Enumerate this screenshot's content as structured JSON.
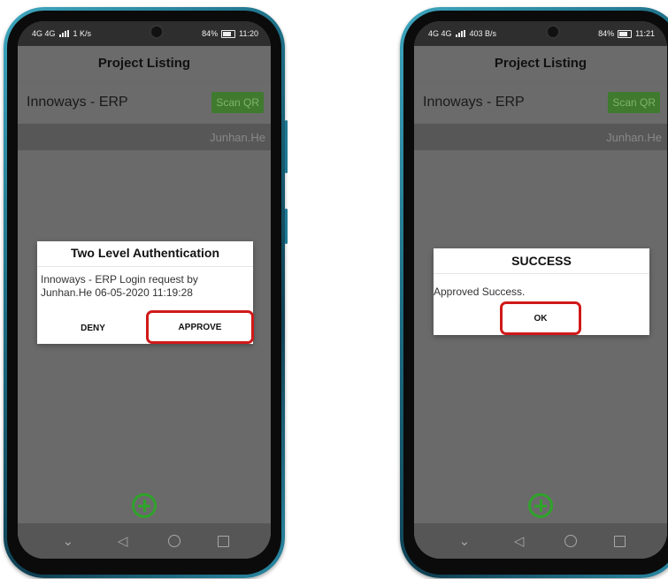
{
  "screen_left": {
    "status": {
      "left_icons": "4G 4G",
      "speed": "1 K/s",
      "right_status": "84%",
      "time": "11:20"
    },
    "app_title": "Project Listing",
    "project": {
      "name": "Innoways - ERP",
      "scan_label": "Scan QR"
    },
    "user": "Junhan.He",
    "dialog": {
      "title": "Two Level Authentication",
      "message": "Innoways - ERP Login request by Junhan.He 06-05-2020 11:19:28",
      "deny_label": "DENY",
      "approve_label": "APPROVE"
    }
  },
  "screen_right": {
    "status": {
      "left_icons": "4G 4G",
      "speed": "403 B/s",
      "right_status": "84%",
      "time": "11:21"
    },
    "app_title": "Project Listing",
    "project": {
      "name": "Innoways - ERP",
      "scan_label": "Scan QR"
    },
    "user": "Junhan.He",
    "dialog": {
      "title": "SUCCESS",
      "message": "Approved Success.",
      "ok_label": "OK"
    }
  },
  "nav": {
    "back": "◁",
    "chevron": "⌄"
  },
  "icons": [
    "add-icon",
    "back-icon",
    "home-icon",
    "recents-icon",
    "chevron-down-icon"
  ]
}
